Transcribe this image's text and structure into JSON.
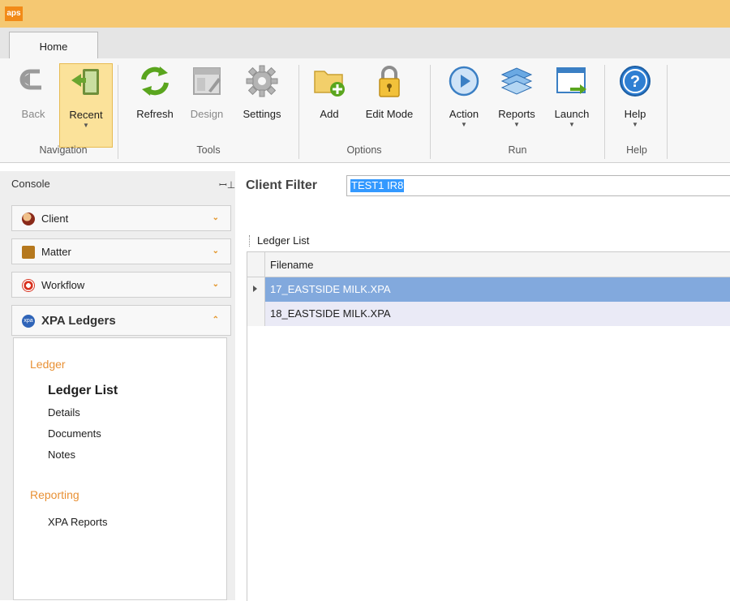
{
  "app": {
    "logo_text": "aps",
    "accent": "#f5c872"
  },
  "tabs": [
    {
      "label": "Home",
      "active": true
    }
  ],
  "ribbon": {
    "buttons": [
      {
        "id": "back",
        "label": "Back",
        "icon": "back-arrow-icon",
        "disabled": true
      },
      {
        "id": "recent",
        "label": "Recent",
        "icon": "recent-book-icon",
        "selected": true,
        "dropdown": true
      },
      {
        "id": "refresh",
        "label": "Refresh",
        "icon": "refresh-icon"
      },
      {
        "id": "design",
        "label": "Design",
        "icon": "design-icon",
        "disabled": true
      },
      {
        "id": "settings",
        "label": "Settings",
        "icon": "gear-icon"
      },
      {
        "id": "add",
        "label": "Add",
        "icon": "folder-add-icon"
      },
      {
        "id": "edit_mode",
        "label": "Edit Mode",
        "icon": "lock-icon"
      },
      {
        "id": "action",
        "label": "Action",
        "icon": "play-icon",
        "dropdown": true
      },
      {
        "id": "reports",
        "label": "Reports",
        "icon": "stack-icon",
        "dropdown": true
      },
      {
        "id": "launch",
        "label": "Launch",
        "icon": "launch-window-icon",
        "dropdown": true
      },
      {
        "id": "help",
        "label": "Help",
        "icon": "question-icon",
        "dropdown": true
      }
    ],
    "groups": [
      "Navigation",
      "Tools",
      "Options",
      "Run",
      "Help"
    ]
  },
  "console": {
    "title": "Console",
    "items": [
      {
        "label": "Client",
        "icon": "client-icon",
        "expanded": false
      },
      {
        "label": "Matter",
        "icon": "matter-icon",
        "expanded": false
      },
      {
        "label": "Workflow",
        "icon": "workflow-icon",
        "expanded": false
      },
      {
        "label": "XPA Ledgers",
        "icon": "xpa-icon",
        "expanded": true
      }
    ],
    "sections": [
      {
        "title": "Ledger",
        "items": [
          "Ledger List",
          "Details",
          "Documents",
          "Notes"
        ],
        "active": "Ledger List"
      },
      {
        "title": "Reporting",
        "items": [
          "XPA Reports"
        ]
      }
    ]
  },
  "filter": {
    "label": "Client Filter",
    "value": "TEST1 IR8"
  },
  "ledger_list": {
    "title": "Ledger List",
    "columns": [
      "Filename"
    ],
    "rows": [
      "17_EASTSIDE MILK.XPA",
      "18_EASTSIDE MILK.XPA"
    ],
    "selected_row": 0
  },
  "colors": {
    "selected_row": "#82a9dd",
    "section_heading": "#e89034",
    "ribbon_selected": "#fbe29a"
  }
}
